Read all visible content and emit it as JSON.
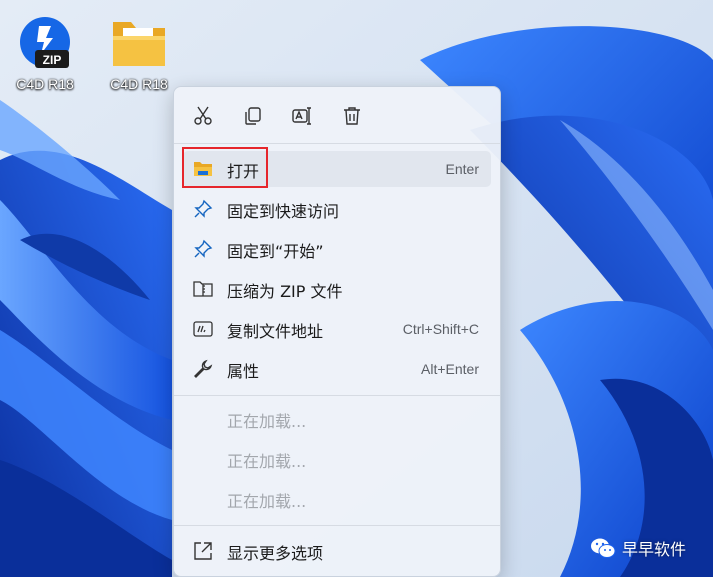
{
  "desktop": {
    "icons": [
      {
        "label": "C4D R18",
        "icon": "zip-archive-icon"
      },
      {
        "label": "C4D R18",
        "icon": "folder-icon"
      }
    ]
  },
  "context_menu": {
    "toolbar": [
      {
        "name": "cut",
        "icon": "scissors-icon"
      },
      {
        "name": "copy",
        "icon": "copy-icon"
      },
      {
        "name": "rename",
        "icon": "rename-icon"
      },
      {
        "name": "delete",
        "icon": "trash-icon"
      }
    ],
    "items": [
      {
        "label": "打开",
        "shortcut": "Enter",
        "icon": "folder-open-icon",
        "selected": true
      },
      {
        "label": "固定到快速访问",
        "shortcut": "",
        "icon": "pin-icon"
      },
      {
        "label": "固定到“开始”",
        "shortcut": "",
        "icon": "pin-icon"
      },
      {
        "label": "压缩为 ZIP 文件",
        "shortcut": "",
        "icon": "zip-folder-icon"
      },
      {
        "label": "复制文件地址",
        "shortcut": "Ctrl+Shift+C",
        "icon": "copy-path-icon"
      },
      {
        "label": "属性",
        "shortcut": "Alt+Enter",
        "icon": "wrench-icon"
      }
    ],
    "loading_items": [
      "正在加载...",
      "正在加载...",
      "正在加载..."
    ],
    "more_options": {
      "label": "显示更多选项",
      "icon": "expand-icon"
    }
  },
  "watermark": {
    "text": "早早软件",
    "icon": "wechat-icon"
  },
  "colors": {
    "highlight": "#e6262c",
    "wallpaper_blue": "#1e63ee",
    "folder_yellow": "#f5c242"
  }
}
